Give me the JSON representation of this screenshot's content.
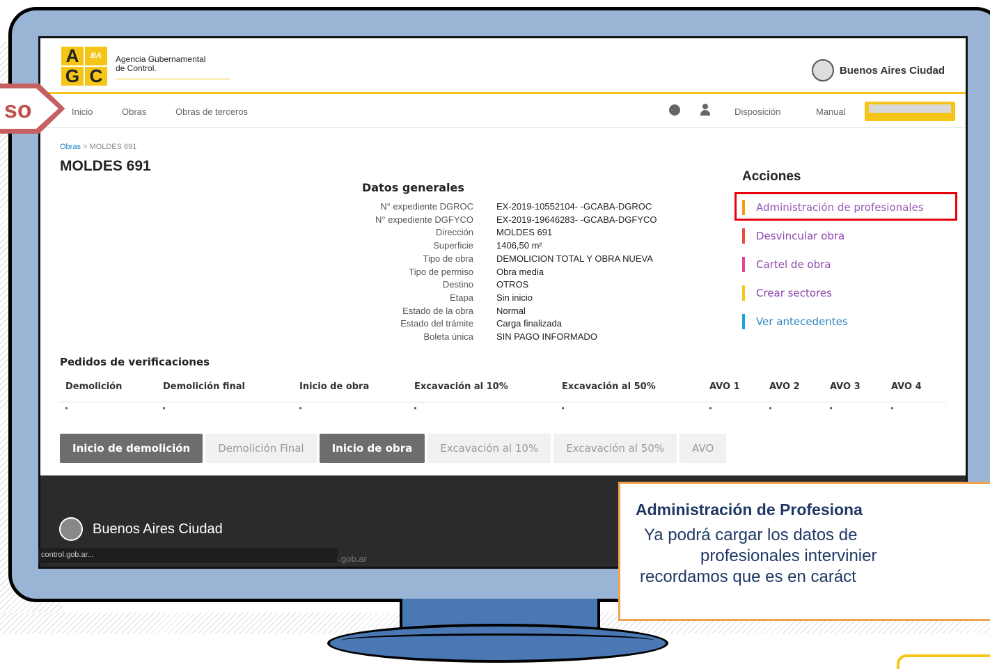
{
  "step_label": "so",
  "header": {
    "logo_letters": [
      "A",
      "BA",
      "G",
      "C"
    ],
    "agency_line1": "Agencia Gubernamental",
    "agency_line2": "de Control.",
    "city_brand": "Buenos Aires Ciudad"
  },
  "nav": {
    "items": [
      "Inicio",
      "Obras",
      "Obras de terceros"
    ],
    "right_items": [
      "Disposición",
      "Manual"
    ],
    "icons": [
      "globe-icon",
      "user-icon"
    ]
  },
  "breadcrumb": {
    "root": "Obras",
    "separator": ">",
    "current": "MOLDES 691"
  },
  "page_title": "MOLDES 691",
  "datos_generales": {
    "title": "Datos generales",
    "rows": [
      {
        "label": "N° expediente DGROC",
        "value": "EX-2019-10552104- -GCABA-DGROC"
      },
      {
        "label": "N° expediente DGFYCO",
        "value": "EX-2019-19646283- -GCABA-DGFYCO"
      },
      {
        "label": "Dirección",
        "value": "MOLDES 691"
      },
      {
        "label": "Superficie",
        "value": "1406,50 m²"
      },
      {
        "label": "Tipo de obra",
        "value": "DEMOLICION TOTAL Y OBRA NUEVA"
      },
      {
        "label": "Tipo de permiso",
        "value": "Obra media"
      },
      {
        "label": "Destino",
        "value": "OTROS"
      },
      {
        "label": "Etapa",
        "value": "Sin inicio"
      },
      {
        "label": "Estado de la obra",
        "value": "Normal"
      },
      {
        "label": "Estado del trámite",
        "value": "Carga finalizada"
      },
      {
        "label": "Boleta única",
        "value": "SIN PAGO INFORMADO"
      }
    ]
  },
  "acciones": {
    "title": "Acciones",
    "items": [
      {
        "label": "Administración de profesionales",
        "color": "#9b59b6",
        "bar": "#f39c12"
      },
      {
        "label": "Desvincular obra",
        "color": "#8e44ad",
        "bar": "#e74c3c"
      },
      {
        "label": "Cartel de obra",
        "color": "#8e44ad",
        "bar": "#e84393"
      },
      {
        "label": "Crear sectores",
        "color": "#8e44ad",
        "bar": "#f5c518"
      },
      {
        "label": "Ver antecedentes",
        "color": "#2e86c1",
        "bar": "#1a9fe0"
      }
    ]
  },
  "verificaciones": {
    "title": "Pedidos de verificaciones",
    "columns": [
      "Demolición",
      "Demolición final",
      "Inicio de obra",
      "Excavación al 10%",
      "Excavación al 50%",
      "AVO 1",
      "AVO 2",
      "AVO 3",
      "AVO 4"
    ]
  },
  "tabs": [
    {
      "label": "Inicio de demolición",
      "active": true
    },
    {
      "label": "Demolición Final",
      "active": false
    },
    {
      "label": "Inicio de obra",
      "active": true
    },
    {
      "label": "Excavación al 10%",
      "active": false
    },
    {
      "label": "Excavación al 50%",
      "active": false
    },
    {
      "label": "AVO",
      "active": false
    }
  ],
  "footer": {
    "brand": "Buenos Aires Ciudad",
    "status_url": "control.gob.ar...",
    "url_partial": "enosaires.gob.ar"
  },
  "callout": {
    "title": "Administración de Profesiona",
    "line1": "Ya podrá cargar los datos de",
    "line2": "profesionales intervinier",
    "line3": "recordamos que es en caráct"
  }
}
